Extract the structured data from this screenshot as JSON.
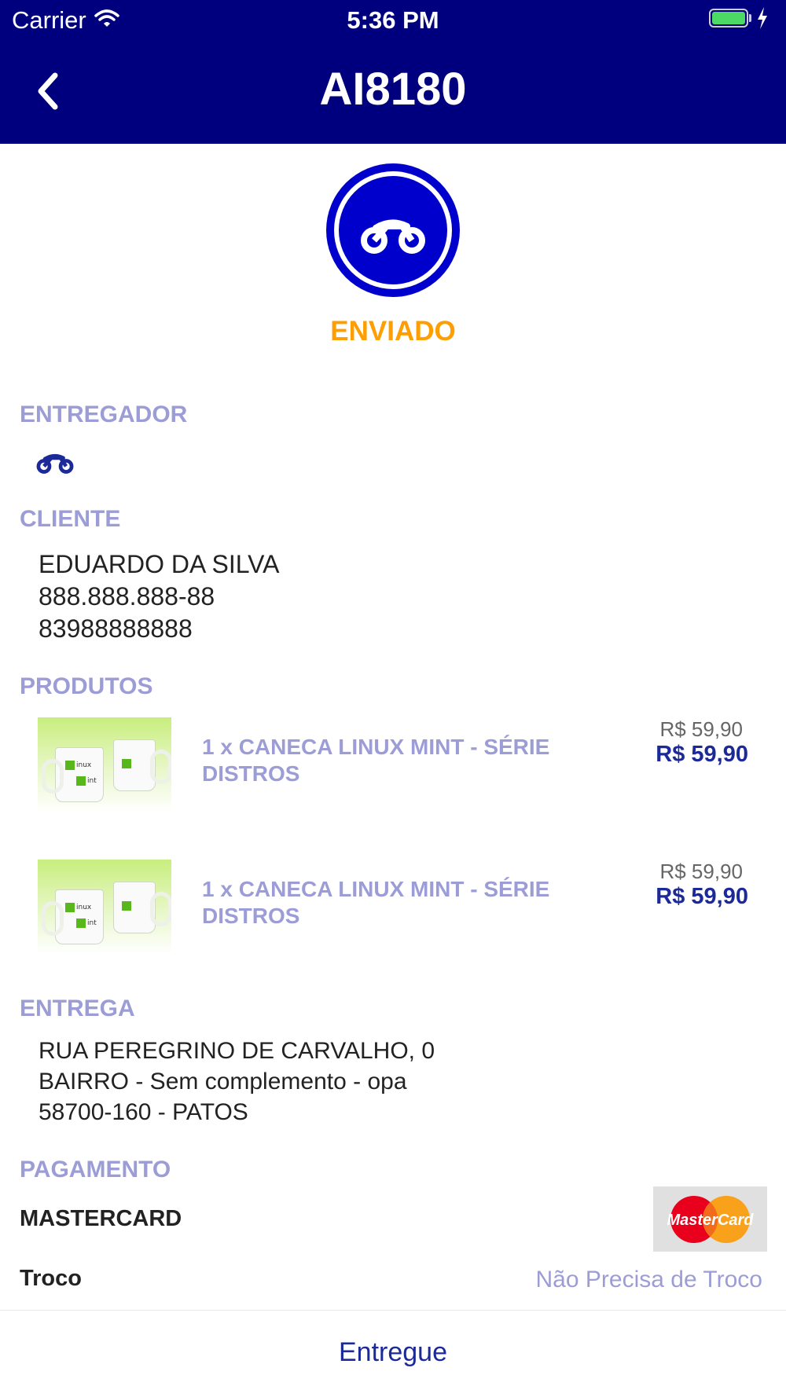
{
  "status_bar": {
    "carrier": "Carrier",
    "time": "5:36 PM"
  },
  "nav": {
    "title": "AI8180",
    "back_icon": "chevron-left-icon"
  },
  "order_status": {
    "label": "ENVIADO",
    "icon": "motorcycle-icon",
    "color": "#ff9e00",
    "circle_color": "#0000cc"
  },
  "sections": {
    "entregador": "ENTREGADOR",
    "cliente": "CLIENTE",
    "produtos": "PRODUTOS",
    "entrega": "ENTREGA",
    "pagamento": "PAGAMENTO"
  },
  "cliente": {
    "name": "EDUARDO DA SILVA",
    "cpf": "888.888.888-88",
    "phone": "83988888888"
  },
  "products": [
    {
      "name_line1": "1 x CANECA LINUX MINT - SÉRIE",
      "name_line2": "DISTROS",
      "unit_price": "R$ 59,90",
      "total_price": "R$ 59,90"
    },
    {
      "name_line1": "1 x CANECA LINUX MINT - SÉRIE",
      "name_line2": "DISTROS",
      "unit_price": "R$ 59,90",
      "total_price": "R$ 59,90"
    }
  ],
  "product_image_text": {
    "linux": "inux",
    "mint": "int",
    "l": "L",
    "m": "m"
  },
  "entrega": {
    "line1": "RUA PEREGRINO DE CARVALHO, 0",
    "line2": "BAIRRO - Sem complemento - opa",
    "line3": "58700-160 - PATOS"
  },
  "pagamento": {
    "method": "MASTERCARD",
    "card_logo_text": "MasterCard",
    "troco_label": "Troco",
    "troco_value": "Não Precisa de Troco"
  },
  "footer": {
    "button_label": "Entregue"
  },
  "colors": {
    "nav_bg": "#00007f",
    "accent": "#1c2a99",
    "section_label": "#9c9dd6"
  }
}
